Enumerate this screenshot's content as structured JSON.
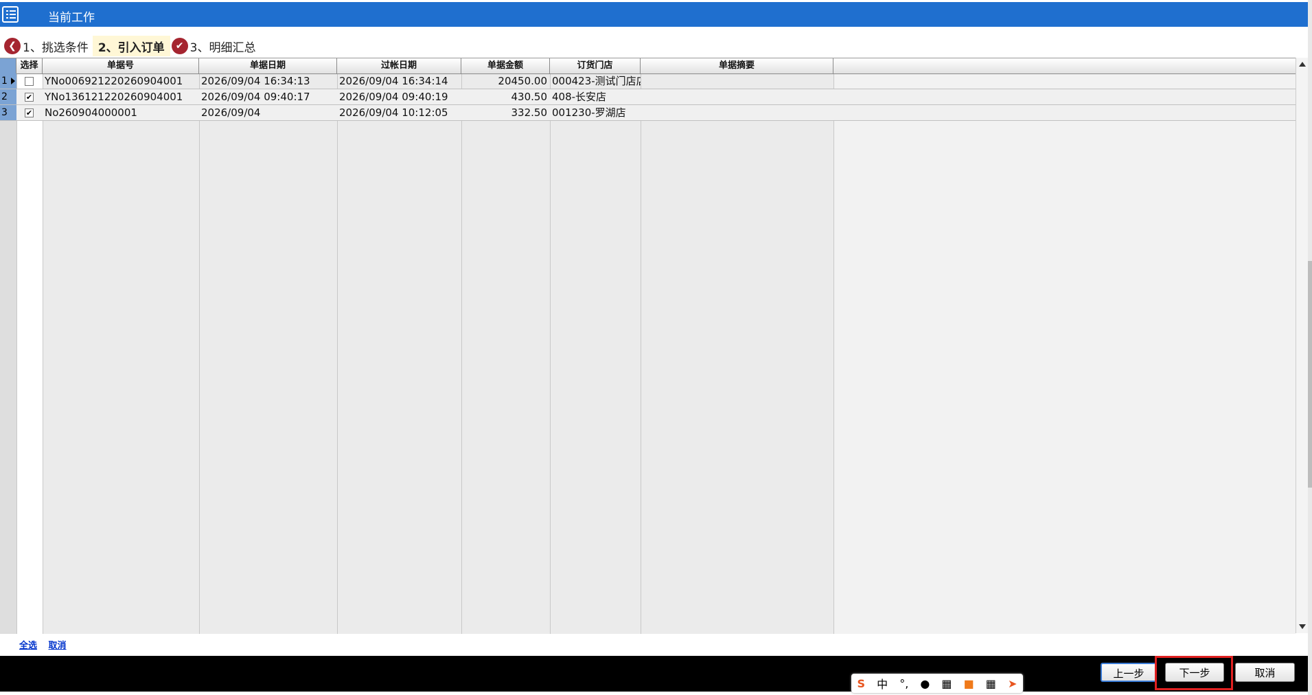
{
  "window": {
    "title": "当前工作"
  },
  "steps": [
    {
      "num": "1",
      "label": "1、挑选条件",
      "state": "done"
    },
    {
      "num": "2",
      "label": "2、引入订单",
      "state": "active"
    },
    {
      "num": "3",
      "label": "3、明细汇总",
      "state": "done"
    }
  ],
  "grid": {
    "columns": [
      "选择",
      "单据号",
      "单据日期",
      "过帐日期",
      "单据金额",
      "订货门店",
      "单据摘要"
    ],
    "rows": [
      {
        "num": "1",
        "checked": false,
        "current": true,
        "doc_no": "YNo006921220260904001",
        "doc_date": "2026/09/04 16:34:13",
        "post_date": "2026/09/04 16:34:14",
        "amount": "20450.00",
        "store": "000423-测试门店店",
        "summary": ""
      },
      {
        "num": "2",
        "checked": true,
        "current": false,
        "doc_no": "YNo136121220260904001",
        "doc_date": "2026/09/04 09:40:17",
        "post_date": "2026/09/04 09:40:19",
        "amount": "430.50",
        "store": "408-长安店",
        "summary": ""
      },
      {
        "num": "3",
        "checked": true,
        "current": false,
        "doc_no": "No260904000001",
        "doc_date": "2026/09/04",
        "post_date": "2026/09/04 10:12:05",
        "amount": "332.50",
        "store": "001230-罗湖店",
        "summary": ""
      }
    ]
  },
  "links": {
    "select_all": "全选",
    "cancel": "取消"
  },
  "buttons": {
    "prev": "上一步",
    "next": "下一步",
    "cancel": "取消"
  },
  "ime": {
    "mode": "中"
  },
  "colors": {
    "titlebar": "#1f6fcf",
    "step_badge": "#a52530",
    "highlight": "#e02020"
  }
}
